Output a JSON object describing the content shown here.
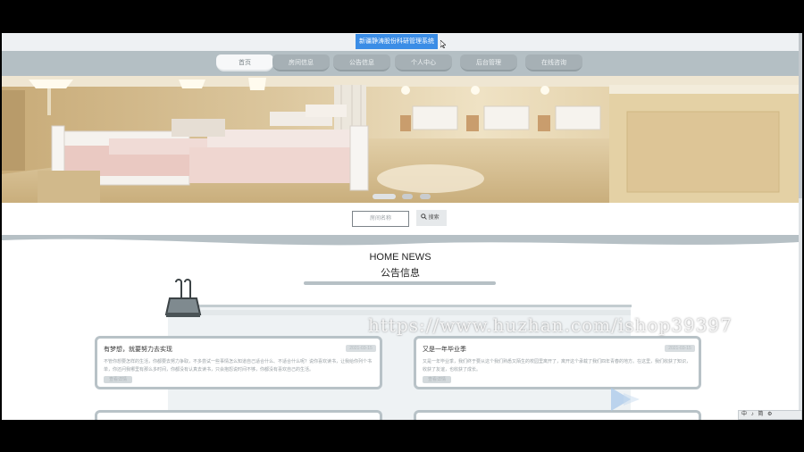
{
  "window": {
    "title": "新疆静涛股份科研管理系统"
  },
  "nav": {
    "items": [
      {
        "label": "首页",
        "active": true
      },
      {
        "label": "房间信息",
        "active": false
      },
      {
        "label": "公告信息",
        "active": false
      },
      {
        "label": "个人中心",
        "active": false
      },
      {
        "label": "后台管理",
        "active": false
      },
      {
        "label": "在线咨询",
        "active": false
      }
    ]
  },
  "banner": {
    "slide_count": 3,
    "active_slide": 1
  },
  "search": {
    "placeholder": "房间名称",
    "button_label": "搜索"
  },
  "section": {
    "title_en": "HOME NEWS",
    "title_cn": "公告信息"
  },
  "cards": [
    {
      "title": "有梦想，就要努力去实现",
      "date": "2021-03-15",
      "excerpt": "不管你想要怎样的生活，你都要去努力争取，不多尝试一些事情怎么知道自己适合什么、不适合什么呢？说你喜欢读书，让我给你列个书单，你还问我哪里有那么多时间，你都没有认真去读书，只会抱怨说时间不够，你都没有喜欢自己的生活。",
      "more": "查看详情"
    },
    {
      "title": "又是一年毕业季",
      "date": "2021-03-15",
      "excerpt": "又是一年毕业季，我们终于要从这个我们熟悉又陌生的校园里离开了，离开这个承载了我们四年青春的地方。在这里，我们收获了知识，收获了友谊，也收获了成长。",
      "more": "查看详情"
    }
  ],
  "watermark": {
    "text": "https://www.huzhan.com/ishop39397"
  },
  "taskbar": {
    "items": [
      "中",
      "♪",
      "简",
      "⚙"
    ]
  },
  "colors": {
    "accent": "#3b8de6",
    "nav_bg": "#b4bfc4",
    "card_border": "#b8c2c7"
  }
}
